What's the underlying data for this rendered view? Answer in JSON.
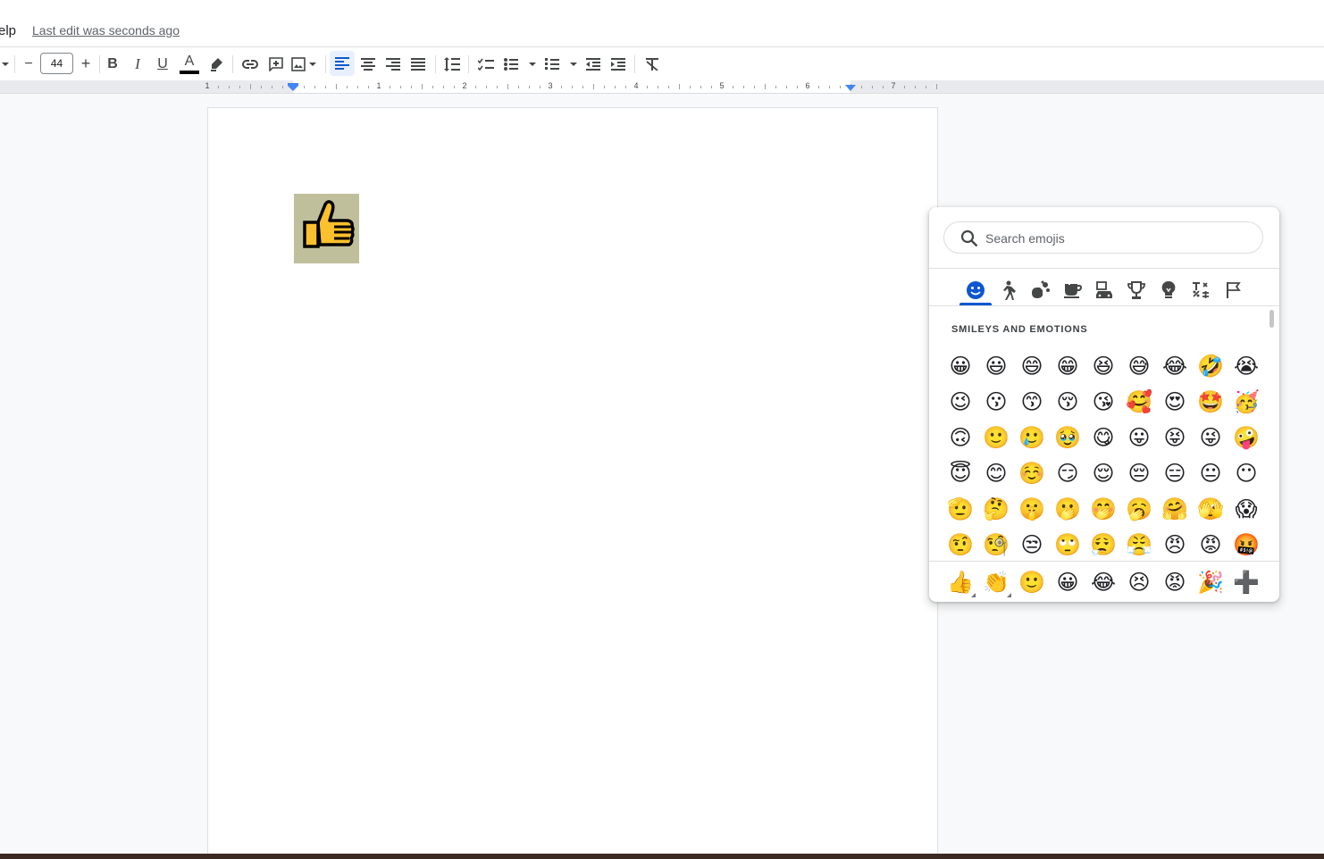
{
  "menubar": {
    "help_label": "elp",
    "last_edit": "Last edit was seconds ago"
  },
  "toolbar": {
    "font_size": "44",
    "decrease_label": "−",
    "increase_label": "+",
    "bold_label": "B",
    "italic_label": "I",
    "underline_label": "U",
    "text_color_label": "A",
    "text_color": "#000000",
    "accent_color": "#0b57d0"
  },
  "ruler": {
    "numbers": [
      "1",
      "1",
      "2",
      "3",
      "4",
      "5",
      "6",
      "7"
    ]
  },
  "document": {
    "image_emoji": "👍",
    "image_background": "#bfbf9c"
  },
  "emoji_panel": {
    "search_placeholder": "Search emojis",
    "categories": [
      "smileys-and-emotions",
      "people",
      "animals-and-nature",
      "food-and-drink",
      "travel-and-places",
      "activities",
      "objects",
      "symbols",
      "flags"
    ],
    "active_category": "smileys-and-emotions",
    "section_title": "SMILEYS AND EMOTIONS",
    "emojis": [
      "😀",
      "😃",
      "😄",
      "😁",
      "😆",
      "😅",
      "😂",
      "🤣",
      "😭",
      "😉",
      "😗",
      "😙",
      "😚",
      "😘",
      "🥰",
      "😍",
      "🤩",
      "🥳",
      "🙃",
      "🙂",
      "🥲",
      "🥹",
      "😋",
      "😛",
      "😝",
      "😜",
      "🤪",
      "😇",
      "😊",
      "☺️",
      "😏",
      "😌",
      "😔",
      "😑",
      "😐",
      "😶",
      "🫡",
      "🤔",
      "🤫",
      "🫢",
      "🤭",
      "🥱",
      "🤗",
      "🫣",
      "😱",
      "🤨",
      "🧐",
      "😒",
      "🙄",
      "😮‍💨",
      "😤",
      "😠",
      "😡",
      "🤬"
    ],
    "recent": [
      "👍",
      "👏",
      "🙂",
      "😀",
      "😂",
      "😣",
      "😡",
      "🎉",
      "➕"
    ]
  }
}
